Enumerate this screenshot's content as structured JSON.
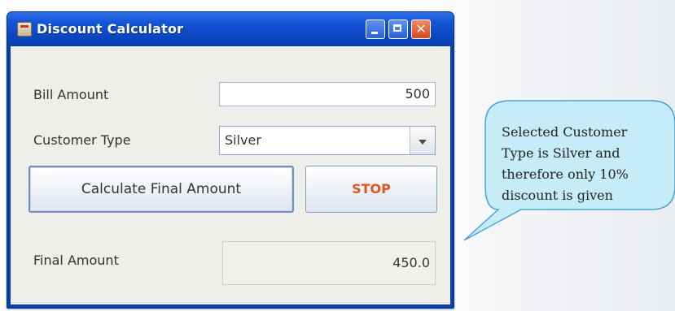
{
  "window": {
    "title": "Discount Calculator"
  },
  "form": {
    "bill_amount_label": "Bill Amount",
    "bill_amount_value": "500",
    "customer_type_label": "Customer Type",
    "customer_type_value": "Silver",
    "calculate_button": "Calculate Final Amount",
    "stop_button": "STOP",
    "final_amount_label": "Final Amount",
    "final_amount_value": "450.0"
  },
  "callout": {
    "lines": [
      "Selected Customer",
      "Type is Silver and",
      "therefore only 10%",
      "discount is given"
    ]
  },
  "colors": {
    "titlebar": "#1455d8",
    "stop_text": "#e0541e",
    "callout_fill": "#c6ecf7",
    "callout_border": "#4aa3d8"
  },
  "icons": {
    "app": "app-icon",
    "minimize": "minimize-icon",
    "maximize": "maximize-icon",
    "close": "close-icon",
    "dropdown": "chevron-down-icon"
  }
}
